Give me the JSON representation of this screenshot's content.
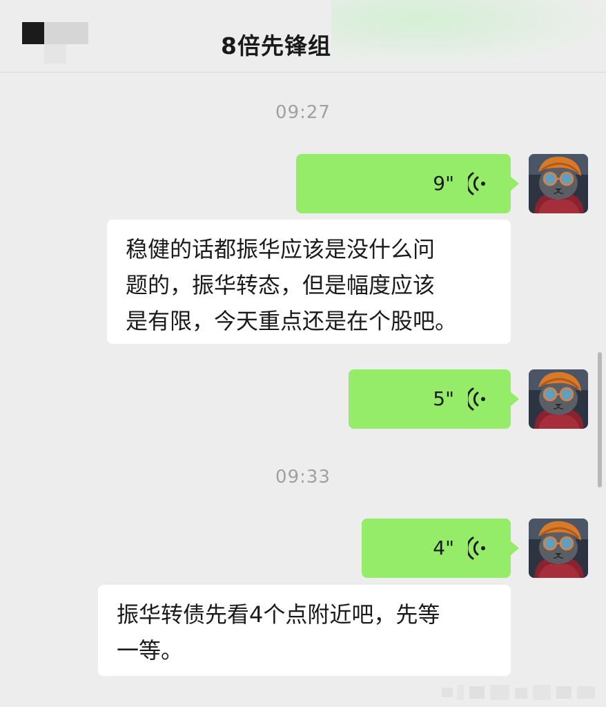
{
  "header": {
    "title": "8倍先锋组"
  },
  "messages": [
    {
      "kind": "timestamp",
      "text": "09:27"
    },
    {
      "kind": "voice",
      "duration": "9\"",
      "sender": "self"
    },
    {
      "kind": "text",
      "lines": [
        "稳健的话都振华应该是没什么问",
        "题的，振华转态，但是幅度应该",
        "是有限，今天重点还是在个股吧。"
      ]
    },
    {
      "kind": "voice",
      "duration": "5\"",
      "sender": "self"
    },
    {
      "kind": "timestamp",
      "text": "09:33"
    },
    {
      "kind": "voice",
      "duration": "4\"",
      "sender": "self"
    },
    {
      "kind": "text",
      "lines": [
        "振华转债先看4个点附近吧，先等",
        "一等。"
      ]
    }
  ],
  "icons": {
    "voice": "voice-wave-icon",
    "avatar": "cat-avatar"
  },
  "colors": {
    "background": "#ededed",
    "outgoing_bubble": "#95ec69",
    "incoming_bubble": "#ffffff",
    "timestamp_text": "#a0a0a0"
  }
}
